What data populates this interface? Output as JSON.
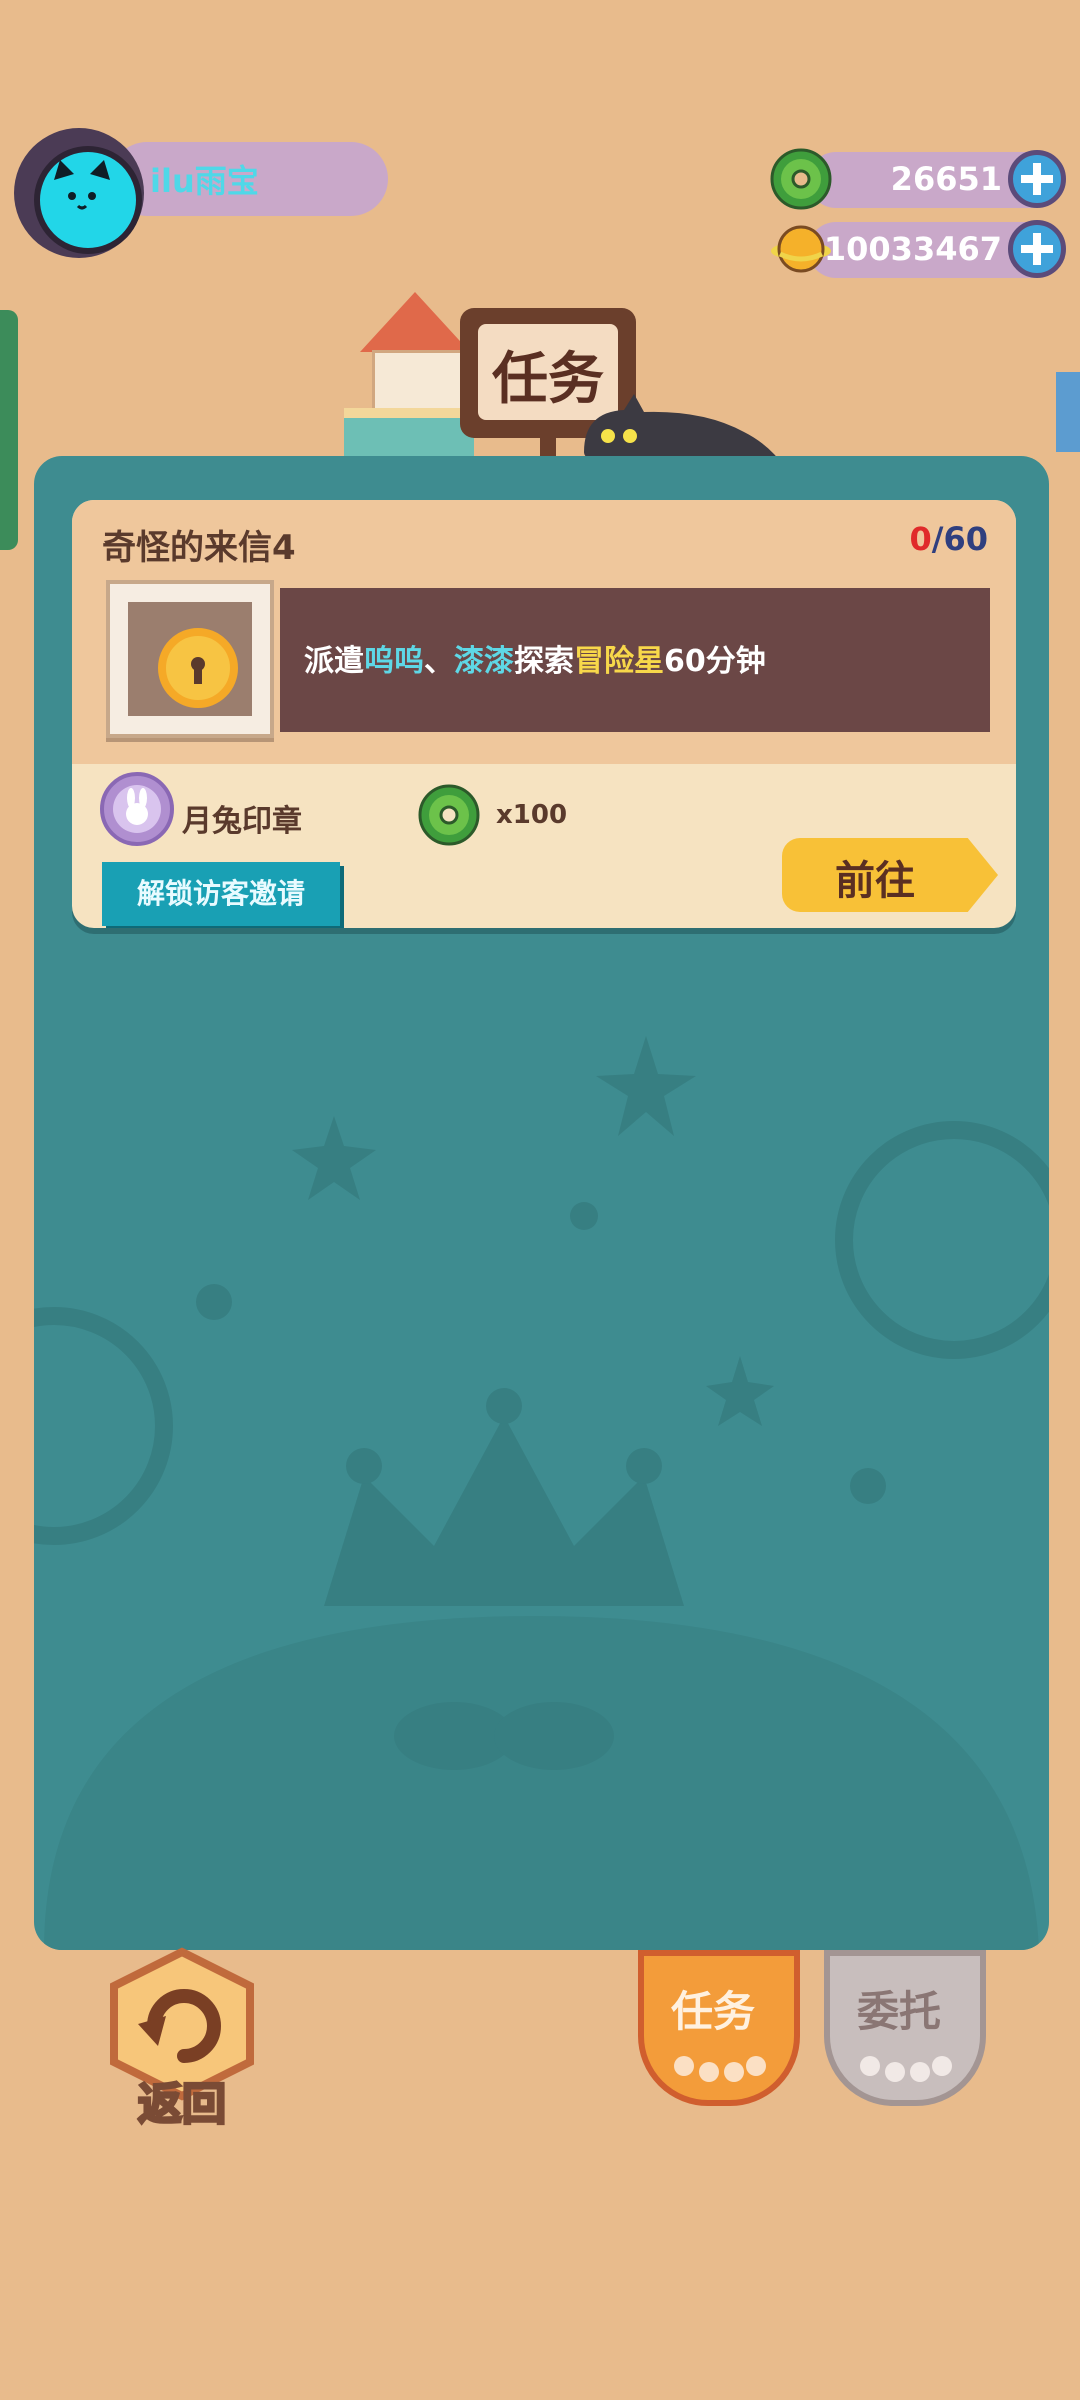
{
  "player": {
    "name": "ilu雨宝"
  },
  "currency": [
    {
      "name": "green-donut-coin",
      "amount": "26651",
      "color": "#3F9E3C"
    },
    {
      "name": "gold-planet-coin",
      "amount": "10033467",
      "color": "#F5B12A"
    }
  ],
  "header": {
    "sign": "任务"
  },
  "task": {
    "title": "奇怪的来信4",
    "progress_current": "0",
    "progress_separator": "/",
    "progress_max": "60",
    "desc_parts": [
      "派遣",
      "呜呜",
      "、",
      "漆漆",
      "探索",
      "冒险星",
      "60分钟"
    ],
    "reward_label": "月兔印章",
    "reward_qty": "x100",
    "unlock": "解锁访客邀请",
    "go": "前往"
  },
  "bottom": {
    "back": "返回",
    "tabs": [
      "任务",
      "委托"
    ]
  },
  "colors": {
    "background": "#E8BB8C",
    "panel": "#3E8C90",
    "accent_yellow": "#F8C137",
    "highlight_blue": "#5ED8E6",
    "highlight_yellow": "#F8D84A"
  }
}
